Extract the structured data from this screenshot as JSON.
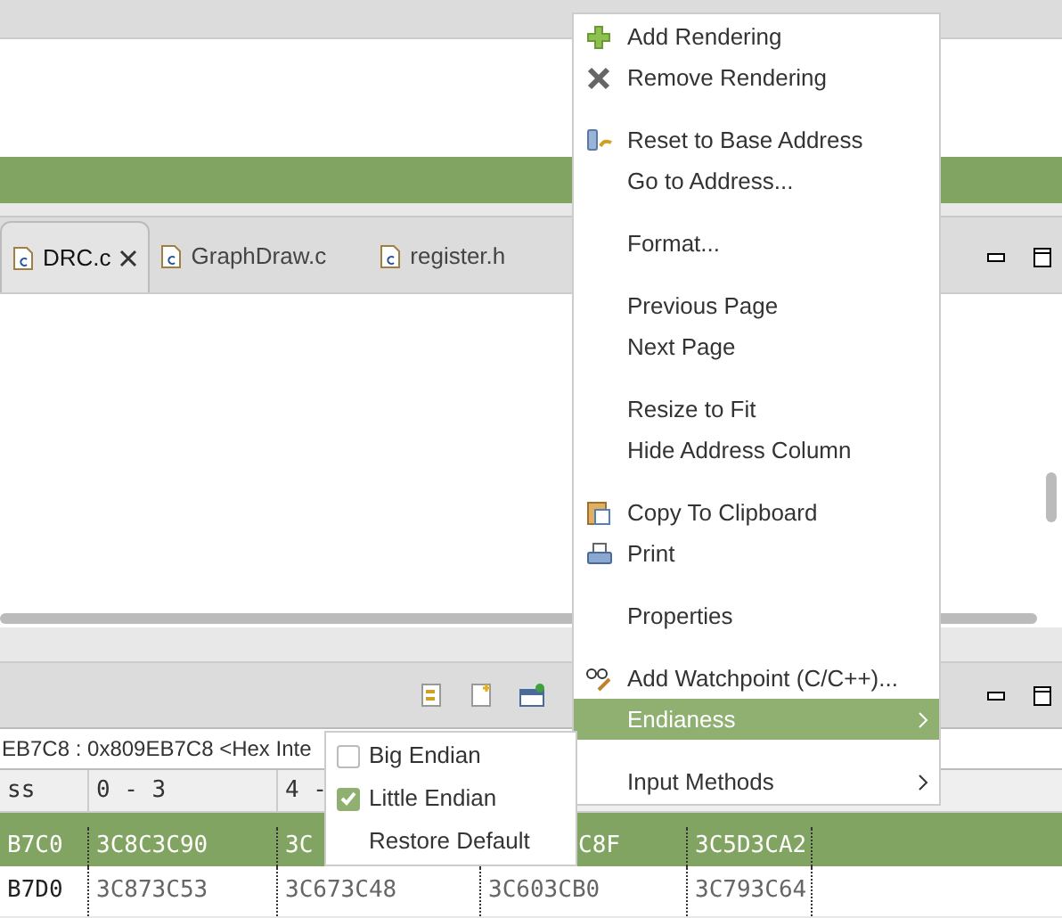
{
  "editor_tabs": [
    {
      "label": "DRC.c",
      "selected": true,
      "closable": true
    },
    {
      "label": "GraphDraw.c",
      "selected": false,
      "closable": false
    },
    {
      "label": "register.h",
      "selected": false,
      "closable": false
    }
  ],
  "memory": {
    "address_bar": "EB7C8 : 0x809EB7C8 <Hex Inte",
    "columns": [
      "ss",
      "0 - 3",
      "4 -"
    ],
    "rows": [
      {
        "selected": true,
        "cells": [
          "B7C0",
          "3C8C3C90",
          "3C",
          "C8F",
          "3C5D3CA2"
        ]
      },
      {
        "selected": false,
        "cells": [
          "B7D0",
          "3C873C53",
          "3C673C48",
          "3C603CB0",
          "3C793C64"
        ]
      }
    ]
  },
  "context_menu": [
    {
      "kind": "action",
      "label": "Add Rendering",
      "selected": false
    },
    {
      "kind": "action",
      "label": "Remove Rendering",
      "selected": false
    },
    {
      "kind": "separator"
    },
    {
      "kind": "action",
      "label": "Reset to Base Address",
      "selected": false
    },
    {
      "kind": "action",
      "label": "Go to Address...",
      "selected": false
    },
    {
      "kind": "separator"
    },
    {
      "kind": "action",
      "label": "Format...",
      "selected": false
    },
    {
      "kind": "separator"
    },
    {
      "kind": "action",
      "label": "Previous Page",
      "selected": false
    },
    {
      "kind": "action",
      "label": "Next Page",
      "selected": false
    },
    {
      "kind": "separator"
    },
    {
      "kind": "action",
      "label": "Resize to Fit",
      "selected": false
    },
    {
      "kind": "action",
      "label": "Hide Address Column",
      "selected": false
    },
    {
      "kind": "separator"
    },
    {
      "kind": "action",
      "label": "Copy To Clipboard",
      "selected": false
    },
    {
      "kind": "action",
      "label": "Print",
      "selected": false
    },
    {
      "kind": "separator"
    },
    {
      "kind": "action",
      "label": "Properties",
      "selected": false
    },
    {
      "kind": "separator"
    },
    {
      "kind": "action",
      "label": "Add Watchpoint (C/C++)...",
      "selected": false
    },
    {
      "kind": "submenu",
      "label": "Endianess",
      "selected": true
    },
    {
      "kind": "separator"
    },
    {
      "kind": "submenu",
      "label": "Input Methods",
      "selected": false
    }
  ],
  "submenu": [
    {
      "kind": "check",
      "label": "Big Endian",
      "checked": false
    },
    {
      "kind": "check",
      "label": "Little Endian",
      "checked": true
    },
    {
      "kind": "action",
      "label": "Restore Default"
    }
  ]
}
